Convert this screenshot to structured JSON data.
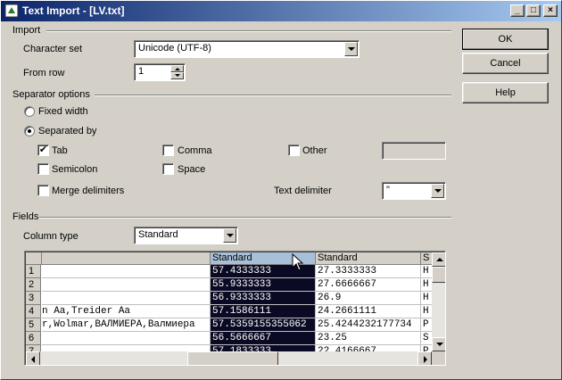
{
  "window": {
    "title": "Text Import - [LV.txt]",
    "minimize": "_",
    "maximize": "□",
    "close": "×"
  },
  "buttons": {
    "ok": "OK",
    "cancel": "Cancel",
    "help": "Help"
  },
  "import": {
    "section": "Import",
    "charset_label": "Character set",
    "charset_value": "Unicode (UTF-8)",
    "fromrow_label": "From row",
    "fromrow_value": "1"
  },
  "separator": {
    "section": "Separator options",
    "fixed_width": "Fixed width",
    "separated_by": "Separated by",
    "mode": "separated_by",
    "tab": "Tab",
    "tab_checked": true,
    "comma": "Comma",
    "comma_checked": false,
    "other": "Other",
    "other_checked": false,
    "other_value": "",
    "semicolon": "Semicolon",
    "semicolon_checked": false,
    "space": "Space",
    "space_checked": false,
    "merge": "Merge delimiters",
    "merge_checked": false,
    "text_delim_label": "Text delimiter",
    "text_delim_value": "\""
  },
  "fields": {
    "section": "Fields",
    "column_type_label": "Column type",
    "column_type_value": "Standard",
    "columns": [
      "Standard",
      "Standard",
      "S"
    ],
    "rows": [
      {
        "num": "1",
        "c0": "",
        "c1": "57.4333333",
        "c2": "27.3333333",
        "c3": "H"
      },
      {
        "num": "2",
        "c0": "",
        "c1": "55.9333333",
        "c2": "27.6666667",
        "c3": "H"
      },
      {
        "num": "3",
        "c0": "",
        "c1": "56.9333333",
        "c2": "26.9",
        "c3": "H"
      },
      {
        "num": "4",
        "c0": "n Aa,Treider Aa",
        "c1": "57.1586111",
        "c2": "24.2661111",
        "c3": "H"
      },
      {
        "num": "5",
        "c0": "r,Wolmar,ВАЛМИЕРА,Валмиера",
        "c1": "57.5359155355062",
        "c2": "25.4244232177734",
        "c3": "P"
      },
      {
        "num": "6",
        "c0": "",
        "c1": "56.5666667",
        "c2": "23.25",
        "c3": "S"
      },
      {
        "num": "7",
        "c0": "",
        "c1": "57.1833333",
        "c2": "22.4166667",
        "c3": "P"
      }
    ]
  }
}
